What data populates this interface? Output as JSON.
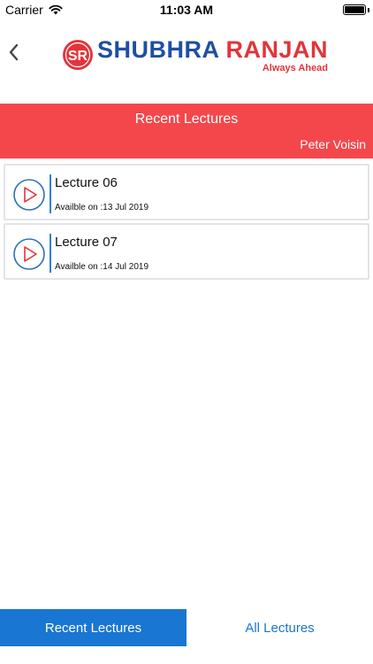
{
  "status_bar": {
    "carrier": "Carrier",
    "time": "11:03 AM"
  },
  "header": {
    "logo_mark": "SR",
    "logo_title_part1": "SHUBHRA",
    "logo_title_part2": "RANJAN",
    "logo_tagline": "Always Ahead"
  },
  "banner": {
    "title": "Recent Lectures",
    "user_name": "Peter Voisin"
  },
  "lectures": [
    {
      "title": "Lecture 06",
      "availability": "Availble on :13 Jul 2019"
    },
    {
      "title": "Lecture 07",
      "availability": "Availble on :14 Jul 2019"
    }
  ],
  "tabs": [
    {
      "label": "Recent Lectures",
      "active": true
    },
    {
      "label": "All Lectures",
      "active": false
    }
  ],
  "colors": {
    "banner_red": "#f4474b",
    "brand_blue": "#1e4fa3",
    "brand_red": "#e2353a",
    "tab_blue": "#1976d2",
    "divider_blue": "#2f7fd8"
  },
  "icons": {
    "back": "chevron-left-icon",
    "play": "play-circle-icon",
    "wifi": "wifi-icon",
    "battery": "battery-icon"
  }
}
